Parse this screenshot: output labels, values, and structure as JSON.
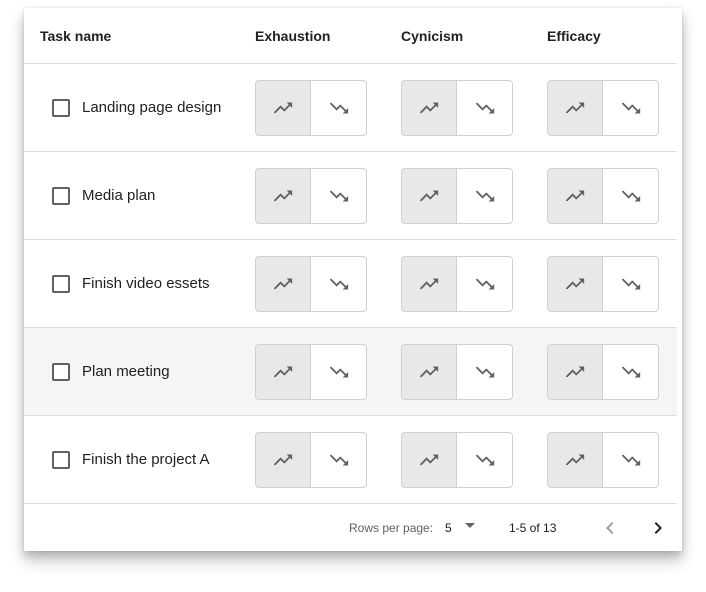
{
  "table": {
    "columns": {
      "task": "Task name",
      "exhaustion": "Exhaustion",
      "cynicism": "Cynicism",
      "efficacy": "Efficacy"
    },
    "rows": [
      {
        "name": "Landing page design",
        "checked": false,
        "highlighted": false
      },
      {
        "name": "Media plan",
        "checked": false,
        "highlighted": false
      },
      {
        "name": "Finish video essets",
        "checked": false,
        "highlighted": false
      },
      {
        "name": "Plan meeting",
        "checked": false,
        "highlighted": true
      },
      {
        "name": "Finish the project A",
        "checked": false,
        "highlighted": false
      }
    ],
    "toggle_selected": "trending-up",
    "icons": [
      "trending-up-icon",
      "trending-down-icon"
    ]
  },
  "pagination": {
    "rows_per_page_label": "Rows per page:",
    "rows_per_page_value": "5",
    "range": "1-5 of 13",
    "prev_icon": "chevron-left-icon",
    "next_icon": "chevron-right-icon"
  },
  "colors": {
    "selected_toggle": "#e8e8e8",
    "row_highlight": "#f5f5f5",
    "icon": "#616161",
    "border": "#d0d0d0"
  }
}
